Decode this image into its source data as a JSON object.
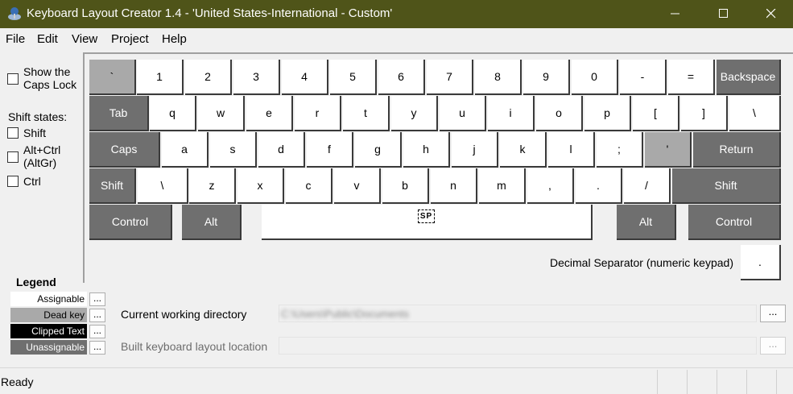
{
  "window": {
    "title": "Keyboard Layout Creator 1.4 - 'United States-International - Custom'"
  },
  "menu": [
    "File",
    "Edit",
    "View",
    "Project",
    "Help"
  ],
  "options": {
    "caps_lock_label_1": "Show the",
    "caps_lock_label_2": "Caps Lock",
    "shift_states_title": "Shift states:",
    "shift_label": "Shift",
    "altctrl_label_1": "Alt+Ctrl",
    "altctrl_label_2": "(AltGr)",
    "ctrl_label": "Ctrl"
  },
  "keyboard": {
    "rows": [
      [
        {
          "label": "`",
          "type": "d"
        },
        {
          "label": "1",
          "type": "a"
        },
        {
          "label": "2",
          "type": "a"
        },
        {
          "label": "3",
          "type": "a"
        },
        {
          "label": "4",
          "type": "a"
        },
        {
          "label": "5",
          "type": "a"
        },
        {
          "label": "6",
          "type": "a"
        },
        {
          "label": "7",
          "type": "a"
        },
        {
          "label": "8",
          "type": "a"
        },
        {
          "label": "9",
          "type": "a"
        },
        {
          "label": "0",
          "type": "a"
        },
        {
          "label": "-",
          "type": "a"
        },
        {
          "label": "=",
          "type": "a"
        },
        {
          "label": "Backspace",
          "type": "u"
        }
      ],
      [
        {
          "label": "Tab",
          "type": "u"
        },
        {
          "label": "q",
          "type": "a"
        },
        {
          "label": "w",
          "type": "a"
        },
        {
          "label": "e",
          "type": "a"
        },
        {
          "label": "r",
          "type": "a"
        },
        {
          "label": "t",
          "type": "a"
        },
        {
          "label": "y",
          "type": "a"
        },
        {
          "label": "u",
          "type": "a"
        },
        {
          "label": "i",
          "type": "a"
        },
        {
          "label": "o",
          "type": "a"
        },
        {
          "label": "p",
          "type": "a"
        },
        {
          "label": "[",
          "type": "a"
        },
        {
          "label": "]",
          "type": "a"
        },
        {
          "label": "\\",
          "type": "a"
        }
      ],
      [
        {
          "label": "Caps",
          "type": "u"
        },
        {
          "label": "a",
          "type": "a"
        },
        {
          "label": "s",
          "type": "a"
        },
        {
          "label": "d",
          "type": "a"
        },
        {
          "label": "f",
          "type": "a"
        },
        {
          "label": "g",
          "type": "a"
        },
        {
          "label": "h",
          "type": "a"
        },
        {
          "label": "j",
          "type": "a"
        },
        {
          "label": "k",
          "type": "a"
        },
        {
          "label": "l",
          "type": "a"
        },
        {
          "label": ";",
          "type": "a"
        },
        {
          "label": "'",
          "type": "d"
        },
        {
          "label": "Return",
          "type": "u"
        }
      ],
      [
        {
          "label": "Shift",
          "type": "u"
        },
        {
          "label": "\\",
          "type": "a"
        },
        {
          "label": "z",
          "type": "a"
        },
        {
          "label": "x",
          "type": "a"
        },
        {
          "label": "c",
          "type": "a"
        },
        {
          "label": "v",
          "type": "a"
        },
        {
          "label": "b",
          "type": "a"
        },
        {
          "label": "n",
          "type": "a"
        },
        {
          "label": "m",
          "type": "a"
        },
        {
          "label": ",",
          "type": "a"
        },
        {
          "label": ".",
          "type": "a"
        },
        {
          "label": "/",
          "type": "a"
        },
        {
          "label": "Shift",
          "type": "u"
        }
      ],
      [
        {
          "label": "Control",
          "type": "u"
        },
        {
          "label": "Alt",
          "type": "u"
        },
        {
          "label": "SP",
          "type": "a"
        },
        {
          "label": "Alt",
          "type": "u"
        },
        {
          "label": "Control",
          "type": "u"
        }
      ]
    ],
    "decimal_separator_label": "Decimal Separator (numeric keypad)",
    "decimal_key": "."
  },
  "legend": {
    "title": "Legend",
    "items": [
      {
        "label": "Assignable",
        "bg": "#ffffff",
        "fg": "#000000"
      },
      {
        "label": "Dead key",
        "bg": "#a9a9a9",
        "fg": "#000000"
      },
      {
        "label": "Clipped Text",
        "bg": "#000000",
        "fg": "#ffffff"
      },
      {
        "label": "Unassignable",
        "bg": "#6f6f6f",
        "fg": "#ffffff"
      }
    ],
    "button_label": "..."
  },
  "directories": {
    "cwd_label": "Current working directory",
    "cwd_value": "C:\\Users\\Public\\Documents",
    "build_label": "Built keyboard layout location",
    "browse_label": "..."
  },
  "status": {
    "text": "Ready"
  }
}
